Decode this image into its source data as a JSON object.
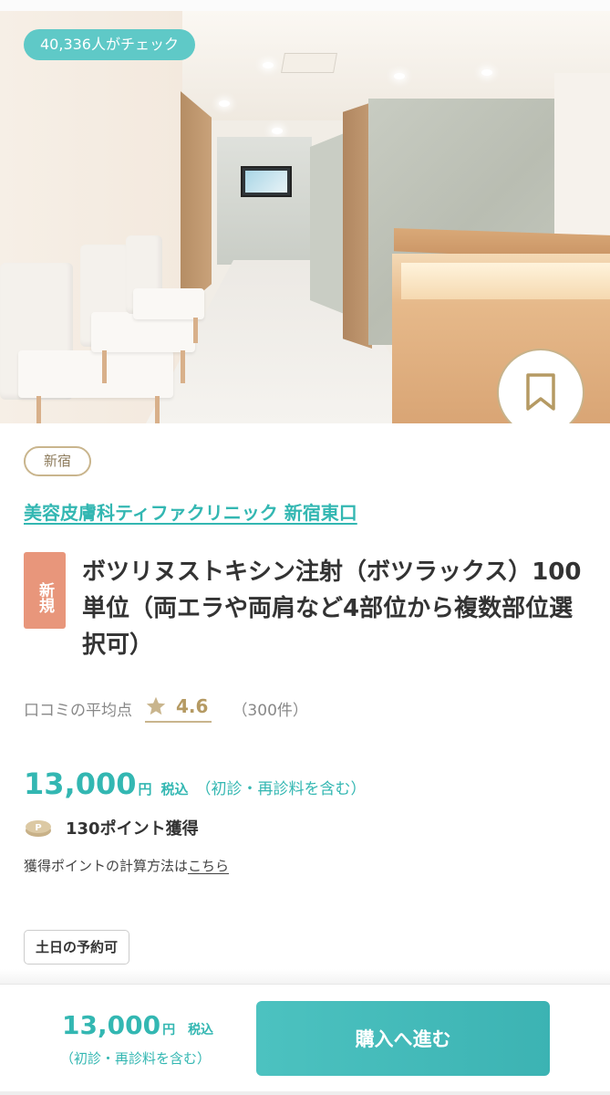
{
  "hero": {
    "check_count": "40,336人がチェック",
    "bookmark_icon": "bookmark-icon"
  },
  "clinic": {
    "area": "新宿",
    "name": "美容皮膚科ティファクリニック 新宿東口"
  },
  "product": {
    "new_label": "新規",
    "title": "ボツリヌストキシン注射（ボツラックス）100単位（両エラや両肩など4部位から複数部位選択可）"
  },
  "rating": {
    "label": "口コミの平均点",
    "star_icon": "star-icon",
    "score": "4.6",
    "count": "（300件）"
  },
  "price": {
    "amount": "13,000",
    "unit": "円",
    "tax": "税込",
    "note": "（初診・再診料を含む）"
  },
  "points": {
    "coin_icon": "point-coin-icon",
    "text": "130ポイント獲得",
    "calc_prefix": "獲得ポイントの計算方法は",
    "calc_link": "こちら"
  },
  "tags": {
    "weekend": "土日の予約可"
  },
  "bottom_bar": {
    "amount": "13,000",
    "unit": "円",
    "tax": "税込",
    "note": "（初診・再診料を含む）",
    "buy_label": "購入へ進む"
  },
  "colors": {
    "accent": "#33b7b2",
    "gold": "#c9b58d",
    "new_tag": "#e8967b"
  }
}
